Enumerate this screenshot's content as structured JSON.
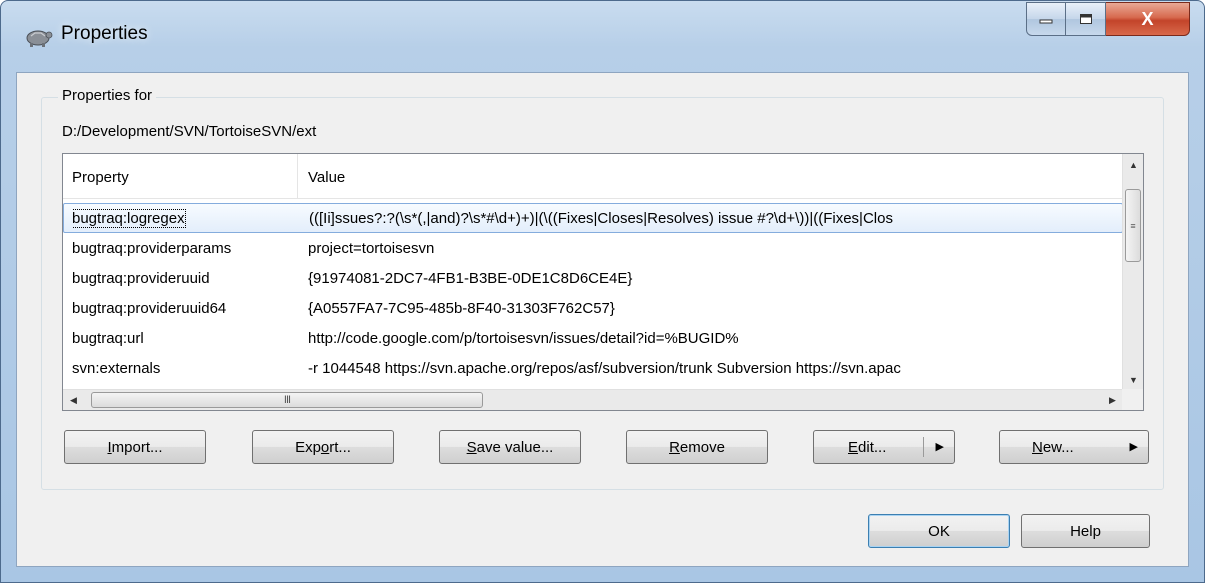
{
  "window": {
    "title": "Properties",
    "close_glyph": "X",
    "icons": {
      "app": "tortoise-svn-icon",
      "minimize": "minimize-icon",
      "maximize": "maximize-icon",
      "close": "close-icon"
    }
  },
  "group": {
    "legend": "Properties for",
    "path": "D:/Development/SVN/TortoiseSVN/ext"
  },
  "list": {
    "columns": [
      "Property",
      "Value"
    ],
    "rows": [
      {
        "property": "bugtraq:logregex",
        "value": "(([Ii]ssues?:?(\\s*(,|and)?\\s*#\\d+)+)|(\\((Fixes|Closes|Resolves) issue #?\\d+\\))|((Fixes|Clos",
        "selected": true
      },
      {
        "property": "bugtraq:providerparams",
        "value": "project=tortoisesvn",
        "selected": false
      },
      {
        "property": "bugtraq:provideruuid",
        "value": "{91974081-2DC7-4FB1-B3BE-0DE1C8D6CE4E}",
        "selected": false
      },
      {
        "property": "bugtraq:provideruuid64",
        "value": "{A0557FA7-7C95-485b-8F40-31303F762C57}",
        "selected": false
      },
      {
        "property": "bugtraq:url",
        "value": "http://code.google.com/p/tortoisesvn/issues/detail?id=%BUGID%",
        "selected": false
      },
      {
        "property": "svn:externals",
        "value": "-r 1044548 https://svn.apache.org/repos/asf/subversion/trunk Subversion https://svn.apac",
        "selected": false
      }
    ],
    "hscroll_grip": "III",
    "vscroll_grip": "≡",
    "arrows": {
      "up": "▲",
      "down": "▼",
      "left": "◀",
      "right": "▶"
    }
  },
  "buttons": {
    "import": {
      "accel": "I",
      "rest": "mport..."
    },
    "export": {
      "pre": "Exp",
      "accel": "o",
      "rest": "rt..."
    },
    "save": {
      "accel": "S",
      "rest": "ave value..."
    },
    "remove": {
      "accel": "R",
      "rest": "emove"
    },
    "edit": {
      "accel": "E",
      "rest": "dit..."
    },
    "new": {
      "accel": "N",
      "rest": "ew..."
    },
    "split_arrow": "▶",
    "ok": "OK",
    "help": "Help"
  },
  "colors": {
    "frame": "#a9c6e4",
    "close_button": "#c3442a",
    "selection": "#e3eefb",
    "selection_border": "#84acdd"
  }
}
